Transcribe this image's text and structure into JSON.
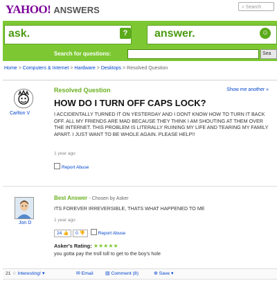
{
  "header": {
    "logo": "YAHOO!",
    "product": "ANSWERS",
    "search_placeholder": "Search"
  },
  "banner": {
    "ask_label": "ask.",
    "answer_label": "answer.",
    "q_icon": "?",
    "smile_icon": "smile-icon",
    "search_label": "Search for questions:",
    "search_button": "Sea"
  },
  "breadcrumb": {
    "items": [
      "Home",
      "Computers & Internet",
      "Hardware",
      "Desktops",
      "Resolved Question"
    ]
  },
  "question": {
    "status": "Resolved Question",
    "show_more": "Show me another »",
    "asker": "Carlton V",
    "title": "HOW DO I TURN OFF CAPS LOCK?",
    "body": "I ACCIDENTALLY TURNED IT ON YESTERDAY AND I DONT KNOW HOW TO TURN IT BACK OFF. ALL MY FRIENDS ARE MAD BECAUSE THEY THINK I AM SHOUTING AT THEM OVER THE INTERNET. THIS PROBLEM IS LITERALLY RUINING MY LIFE AND TEARING MY FAMILY APART. I JUST WANT TO BE WHOLE AGAIN. PLEASE HELP!!",
    "time": "1 year ago",
    "report": "Report Abuse"
  },
  "answer": {
    "label": "Best Answer",
    "chosen": "- Chosen by Asker",
    "answerer": "Jon D",
    "text": "ITS FOREVER IRREVERSIBLE, THATS WHAT HAPPENED TO ME",
    "time": "1 year ago",
    "thumbs_up": "24",
    "thumbs_down": "0",
    "report": "Report Abuse",
    "rating_label": "Asker's Rating:",
    "stars": "★★★★★",
    "comment": "you gotta pay the troll toll to get to the boy's hole"
  },
  "footer": {
    "interesting_count": "21",
    "interesting": "Interesting!",
    "email": "Email",
    "comment": "Comment (8)",
    "save": "Save"
  },
  "colors": {
    "brand": "#7b0099",
    "green": "#7dc832",
    "link": "#0044cc"
  }
}
